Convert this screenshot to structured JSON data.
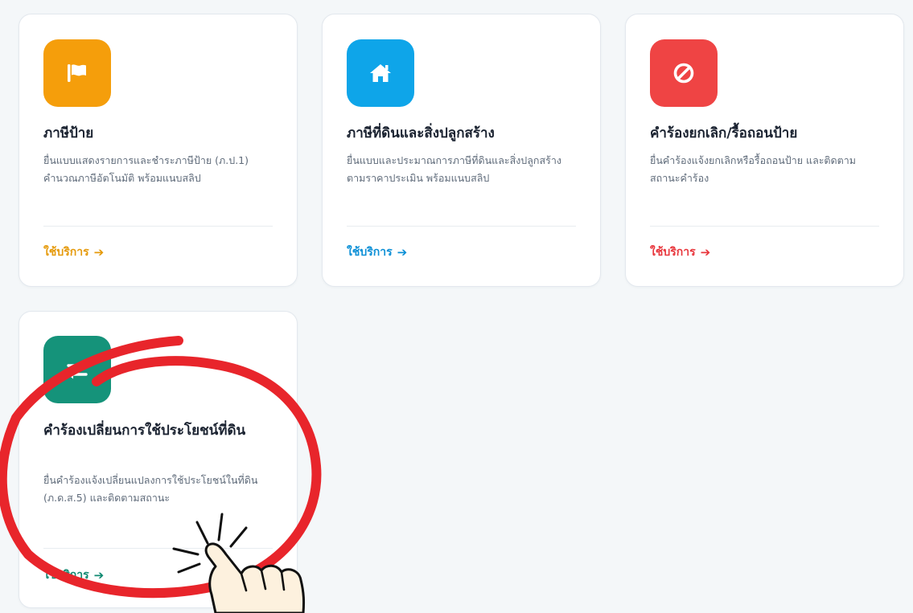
{
  "cards": [
    {
      "icon": "flag-icon",
      "color": "#f59e0b",
      "title": "ภาษีป้าย",
      "description": "ยื่นแบบแสดงรายการและชำระภาษีป้าย (ภ.ป.1) คำนวณภาษีอัตโนมัติ พร้อมแนบสลิป",
      "link_label": "ใช้บริการ",
      "arrow": "➔"
    },
    {
      "icon": "home-icon",
      "color": "#0ea5e9",
      "title": "ภาษีที่ดินและสิ่งปลูกสร้าง",
      "description": "ยื่นแบบและประมาณการภาษีที่ดินและสิ่งปลูกสร้างตามราคาประเมิน พร้อมแนบสลิป",
      "link_label": "ใช้บริการ",
      "arrow": "➔"
    },
    {
      "icon": "ban-icon",
      "color": "#ef4444",
      "title": "คำร้องยกเลิก/รื้อถอนป้าย",
      "description": "ยื่นคำร้องแจ้งยกเลิกหรือรื้อถอนป้าย และติดตามสถานะคำร้อง",
      "link_label": "ใช้บริการ",
      "arrow": "➔"
    },
    {
      "icon": "exchange-icon",
      "color": "#15937a",
      "title": "คำร้องเปลี่ยนการใช้ประโยชน์ที่ดิน",
      "description": "ยื่นคำร้องแจ้งเปลี่ยนแปลงการใช้ประโยชน์ในที่ดิน (ภ.ด.ส.5) และติดตามสถานะ",
      "link_label": "ใช้บริการ",
      "arrow": "➔"
    }
  ],
  "annotation": {
    "circle_color": "#e8252b",
    "hand_icon": "pointing-hand-icon",
    "hand_fill": "#fdf1de"
  }
}
